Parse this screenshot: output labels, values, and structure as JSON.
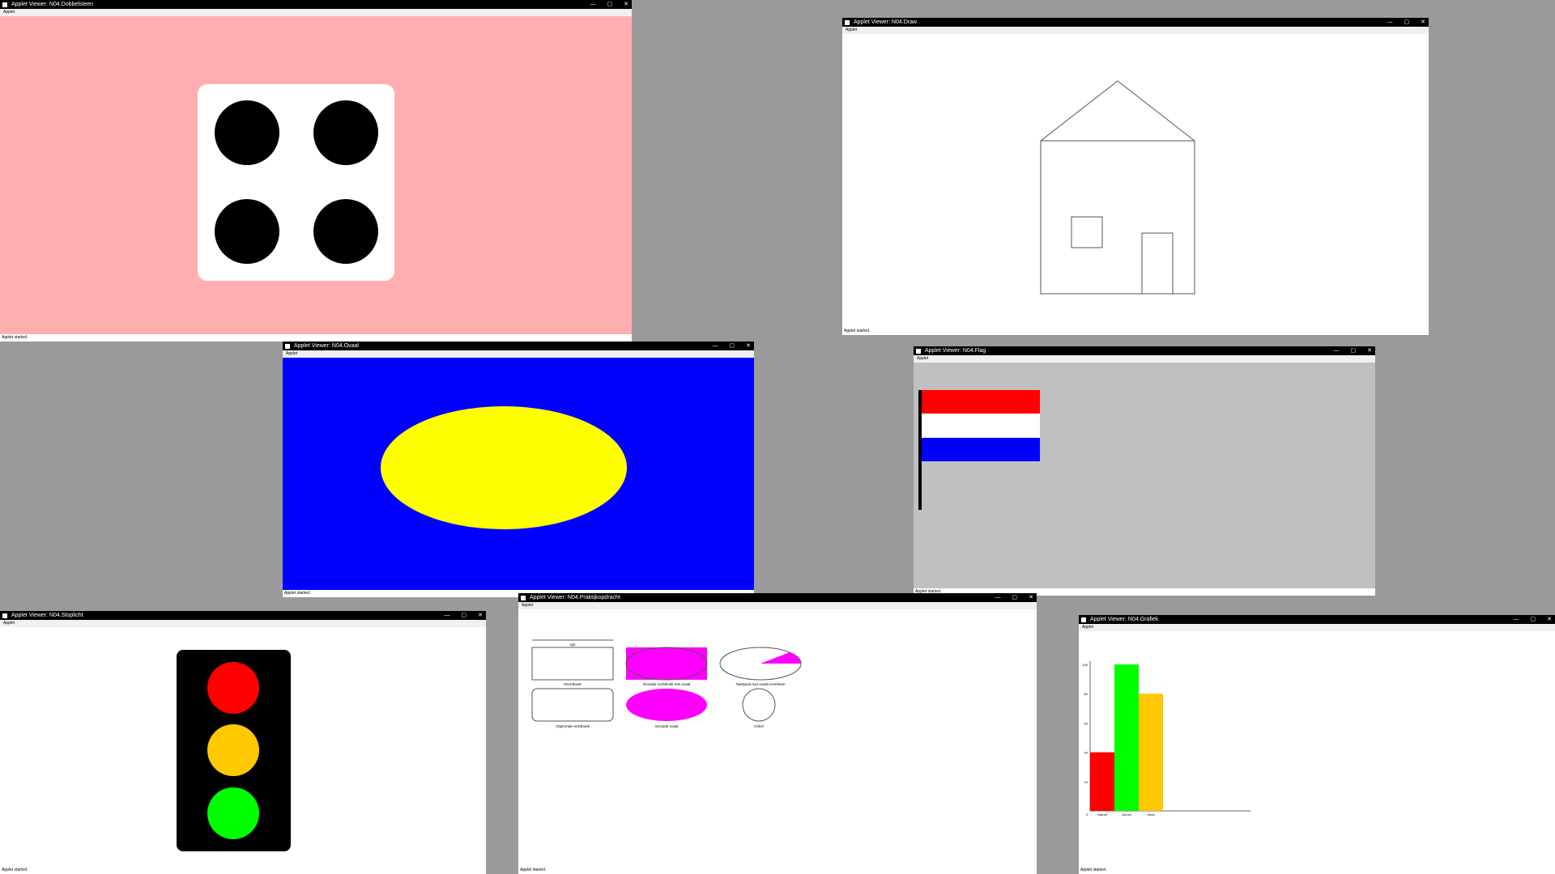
{
  "windows": {
    "dobbelsteen": {
      "title": "Applet Viewer: N04.Dobbelsteen",
      "menu": "Applet",
      "status": "Applet started."
    },
    "draw": {
      "title": "Applet Viewer: N04.Draw",
      "menu": "Applet",
      "status": "Applet started."
    },
    "ovaal": {
      "title": "Applet Viewer: N04.Ovaal",
      "menu": "Applet",
      "status": "Applet started."
    },
    "flag": {
      "title": "Applet Viewer: N04.Flag",
      "menu": "Applet",
      "status": "Applet started."
    },
    "stoplicht": {
      "title": "Applet Viewer: N04.Stoplicht",
      "menu": "Applet",
      "status": "Applet started."
    },
    "praktijk": {
      "title": "Applet Viewer: N04.Praktijkopdracht",
      "menu": "Applet",
      "status": "Applet started.",
      "labels": {
        "lijn": "Lijn",
        "rechthoek": "Rechthoek",
        "gevulde_rechthoek_ovaal": "Gevulde rechthoek met ovaal",
        "taartpunt": "Taartpunt met ovaal eromheen",
        "afgeronde_rechthoek": "Afgeronde rechthoek",
        "gevulde_ovaal": "Gevulde ovaal",
        "cirkel": "Cirkel"
      }
    },
    "grafiek": {
      "title": "Applet Viewer: N04.Grafiek",
      "menu": "Applet",
      "status": "Applet started."
    }
  },
  "window_controls": {
    "minimize": "—",
    "maximize": "▢",
    "close": "✕"
  },
  "colors": {
    "desktop": "#9a9a9a",
    "dice_bg": "#ffafaf",
    "ovaal_bg": "#0000ff",
    "ovaal_fill": "#ffff00",
    "flag_bg": "#c0c0c0",
    "flag_red": "#ff0000",
    "flag_white": "#ffffff",
    "flag_blue": "#0000ff",
    "magenta": "#ff00ff",
    "traffic_red": "#ff0000",
    "traffic_orange": "#ffc800",
    "traffic_green": "#00ff00"
  },
  "dice": {
    "pips": 4
  },
  "chart_data": {
    "type": "bar",
    "categories": [
      "Valerie",
      "Jeroen",
      "Hans"
    ],
    "values": [
      40,
      100,
      80
    ],
    "colors": [
      "#ff0000",
      "#00ff00",
      "#ffc800"
    ],
    "yticks": [
      0,
      20,
      40,
      60,
      80,
      100
    ],
    "ylim": [
      0,
      100
    ]
  }
}
